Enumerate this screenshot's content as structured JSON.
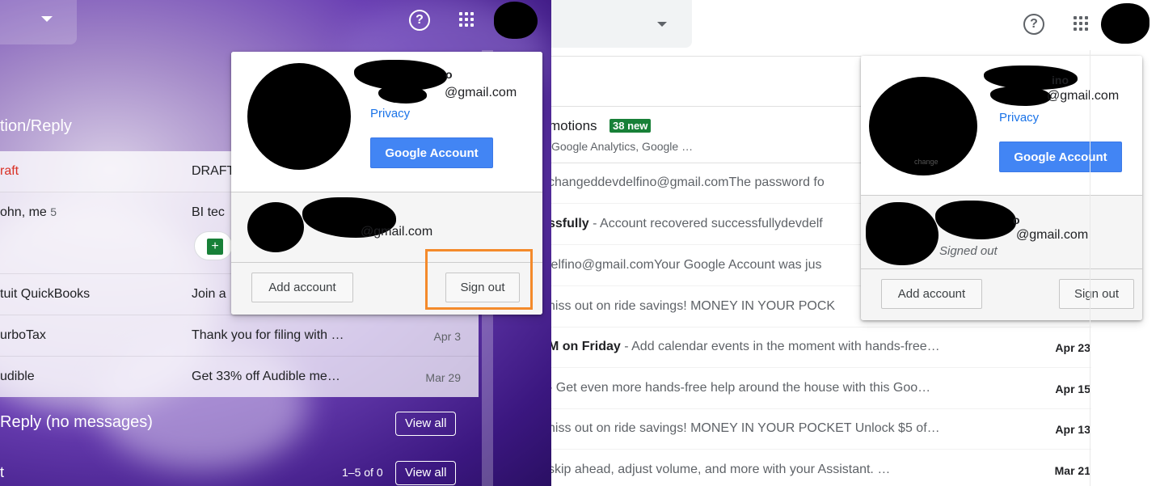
{
  "left_pane": {
    "section_title": "tion/Reply",
    "rows": [
      {
        "sender": "raft",
        "subject": "DRAFT",
        "date": ""
      },
      {
        "sender": "ohn, me",
        "count": "5",
        "subject": "BI tec",
        "date": ""
      },
      {
        "sender": "tuit QuickBooks",
        "subject": "Join a",
        "date": ""
      },
      {
        "sender": "urboTax",
        "subject": "Thank you for filing with …",
        "date": "Apr 3"
      },
      {
        "sender": "udible",
        "subject": "Get 33% off Audible me…",
        "date": "Mar 29"
      }
    ],
    "reply_section": "Reply (no messages)",
    "view_all_1": "View all",
    "view_all_2": "View all",
    "pagination": "1–5 of 0",
    "bottom_char": "t"
  },
  "left_popup": {
    "name_partial": "o",
    "email_partial": "@gmail.com",
    "privacy": "Privacy",
    "google_account": "Google Account",
    "second_email_partial": "@gmail.com",
    "add_account": "Add account",
    "sign_out": "Sign out"
  },
  "right_pane": {
    "promotions_label": "motions",
    "promotions_badge": "38 new",
    "promotions_sub": "Google Analytics, Google …",
    "rows": [
      {
        "bold": "",
        "text": "changeddevdelfino@gmail.comThe password fo",
        "date": ""
      },
      {
        "bold": "ssfully",
        "text": " - Account recovered successfullydevdelf",
        "date": ""
      },
      {
        "bold": "",
        "text": "lelfino@gmail.comYour Google Account was jus",
        "date": ""
      },
      {
        "bold": "",
        "text": "niss out on ride savings! MONEY IN YOUR POCK",
        "date": ""
      },
      {
        "bold": "M on Friday",
        "text": " - Add calendar events in the moment with hands-free…",
        "date": "Apr 23"
      },
      {
        "bold": "",
        "text": " - Get even more hands-free help around the house with this Goo…",
        "date": "Apr 15"
      },
      {
        "bold": "",
        "text": "niss out on ride savings! MONEY IN YOUR POCKET Unlock $5 of…",
        "date": "Apr 13"
      },
      {
        "bold": "",
        "text": "skip ahead, adjust volume, and more with your Assistant.          …",
        "date": "Mar 21"
      }
    ]
  },
  "right_popup": {
    "name_partial": "ino",
    "email_partial": "@gmail.com",
    "privacy": "Privacy",
    "google_account": "Google Account",
    "avatar_text": "change",
    "second_name_partial": "o",
    "second_email_partial": "@gmail.com",
    "signed_out": "Signed out",
    "add_account": "Add account",
    "sign_out": "Sign out"
  },
  "icons": {
    "help": "help-circle-icon",
    "apps": "apps-grid-icon",
    "dropdown": "chevron-down-icon"
  },
  "colors": {
    "google_blue": "#4285f4",
    "link_blue": "#1a73e8",
    "badge_green": "#188038",
    "draft_red": "#d93025",
    "highlight_orange": "#f48a2b"
  }
}
